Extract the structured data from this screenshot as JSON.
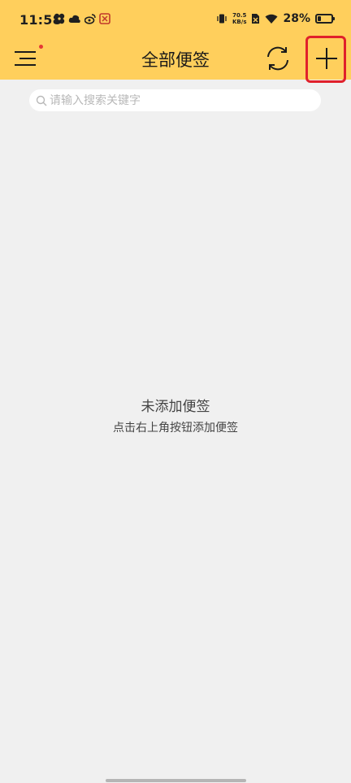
{
  "status_bar": {
    "time": "11:58",
    "net_speed_value": "70.5",
    "net_speed_unit": "KB/s",
    "battery_percent": "28%",
    "battery_level": 0.28
  },
  "header": {
    "title": "全部便签"
  },
  "search": {
    "placeholder": "请输入搜索关键字"
  },
  "empty_state": {
    "title": "未添加便签",
    "hint": "点击右上角按钮添加便签"
  },
  "colors": {
    "header_bg": "#ffcf5c",
    "page_bg": "#f0f0f0",
    "highlight_border": "#e0212b",
    "notification_dot": "#e53935"
  }
}
